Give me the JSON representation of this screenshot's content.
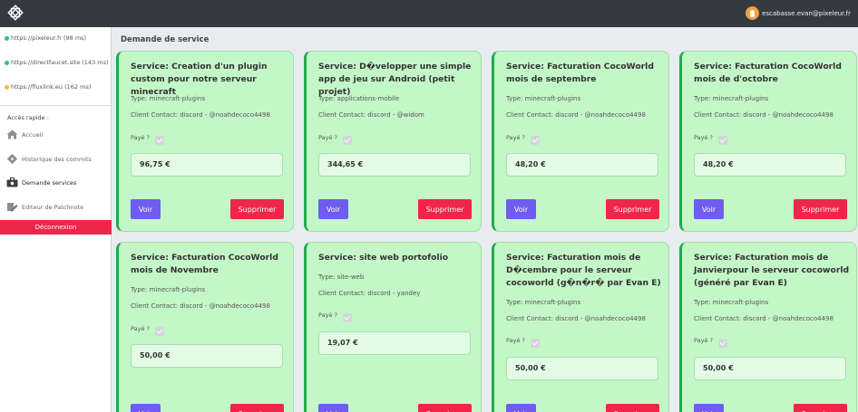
{
  "header": {
    "user_email": "escabasse.evan@pixeleur.fr"
  },
  "sidebar": {
    "statuses": [
      {
        "label": "https://pixeleur.fr (98 ms)",
        "color": "#28c76f"
      },
      {
        "label": "https://directfaucet.site (143 ms)",
        "color": "#28c76f"
      },
      {
        "label": "https://fluxlink.eu (162 ms)",
        "color": "#f5c242"
      }
    ],
    "quick_access_title": "Accès rapide :",
    "nav": [
      {
        "label": "Accueil",
        "icon": "home-icon"
      },
      {
        "label": "Historique des commits",
        "icon": "git-icon"
      },
      {
        "label": "Demande services",
        "icon": "toolbox-icon"
      },
      {
        "label": "Editeur de Patchnote",
        "icon": "edit-icon"
      }
    ],
    "logout_label": "Déconnexion"
  },
  "main": {
    "page_title": "Demande de service",
    "paid_label": "Payé ?",
    "view_label": "Voir",
    "delete_label": "Supprimer",
    "cards": [
      {
        "title": "Service: Creation d'un plugin custom pour notre serveur minecraft",
        "type": "Type: minecraft-plugins",
        "contact": "Client Contact: discord - @noahdecoco4498",
        "amount": "96,75 €",
        "paid": true
      },
      {
        "title": "Service: D�velopper une simple app de jeu sur Android (petit projet)",
        "type": "Type: applications-mobile",
        "contact": "Client Contact: discord - @widom",
        "amount": "344,65 €",
        "paid": true
      },
      {
        "title": "Service: Facturation CocoWorld mois de septembre",
        "type": "Type: minecraft-plugins",
        "contact": "Client Contact: discord - @noahdecoco4498",
        "amount": "48,20 €",
        "paid": true
      },
      {
        "title": "Service: Facturation CocoWorld mois de d'octobre",
        "type": "Type: minecraft-plugins",
        "contact": "Client Contact: discord - @noahdecoco4498",
        "amount": "48,20 €",
        "paid": true
      },
      {
        "title": "Service: Facturation CocoWorld mois de Novembre",
        "type": "Type: minecraft-plugins",
        "contact": "Client Contact: discord - @noahdecoco4498",
        "amount": "50,00 €",
        "paid": true
      },
      {
        "title": "Service: site web portofolio",
        "type": "Type: site-web",
        "contact": "Client Contact: discord - yandey",
        "amount": "19,07 €",
        "paid": true
      },
      {
        "title": "Service: Facturation mois de D�cembre pour le serveur cocoworld (g�n�r� par Evan E)",
        "type": "Type: minecraft-plugins",
        "contact": "Client Contact: discord - @noahdecoco4498",
        "amount": "50,00 €",
        "paid": true
      },
      {
        "title": "Service: Facturation mois de Janvierpour le serveur cocoworld (généré par Evan E)",
        "type": "Type: minecraft-plugins",
        "contact": "Client Contact: discord - @noahdecoco4498",
        "amount": "50,00 €",
        "paid": true
      }
    ]
  }
}
